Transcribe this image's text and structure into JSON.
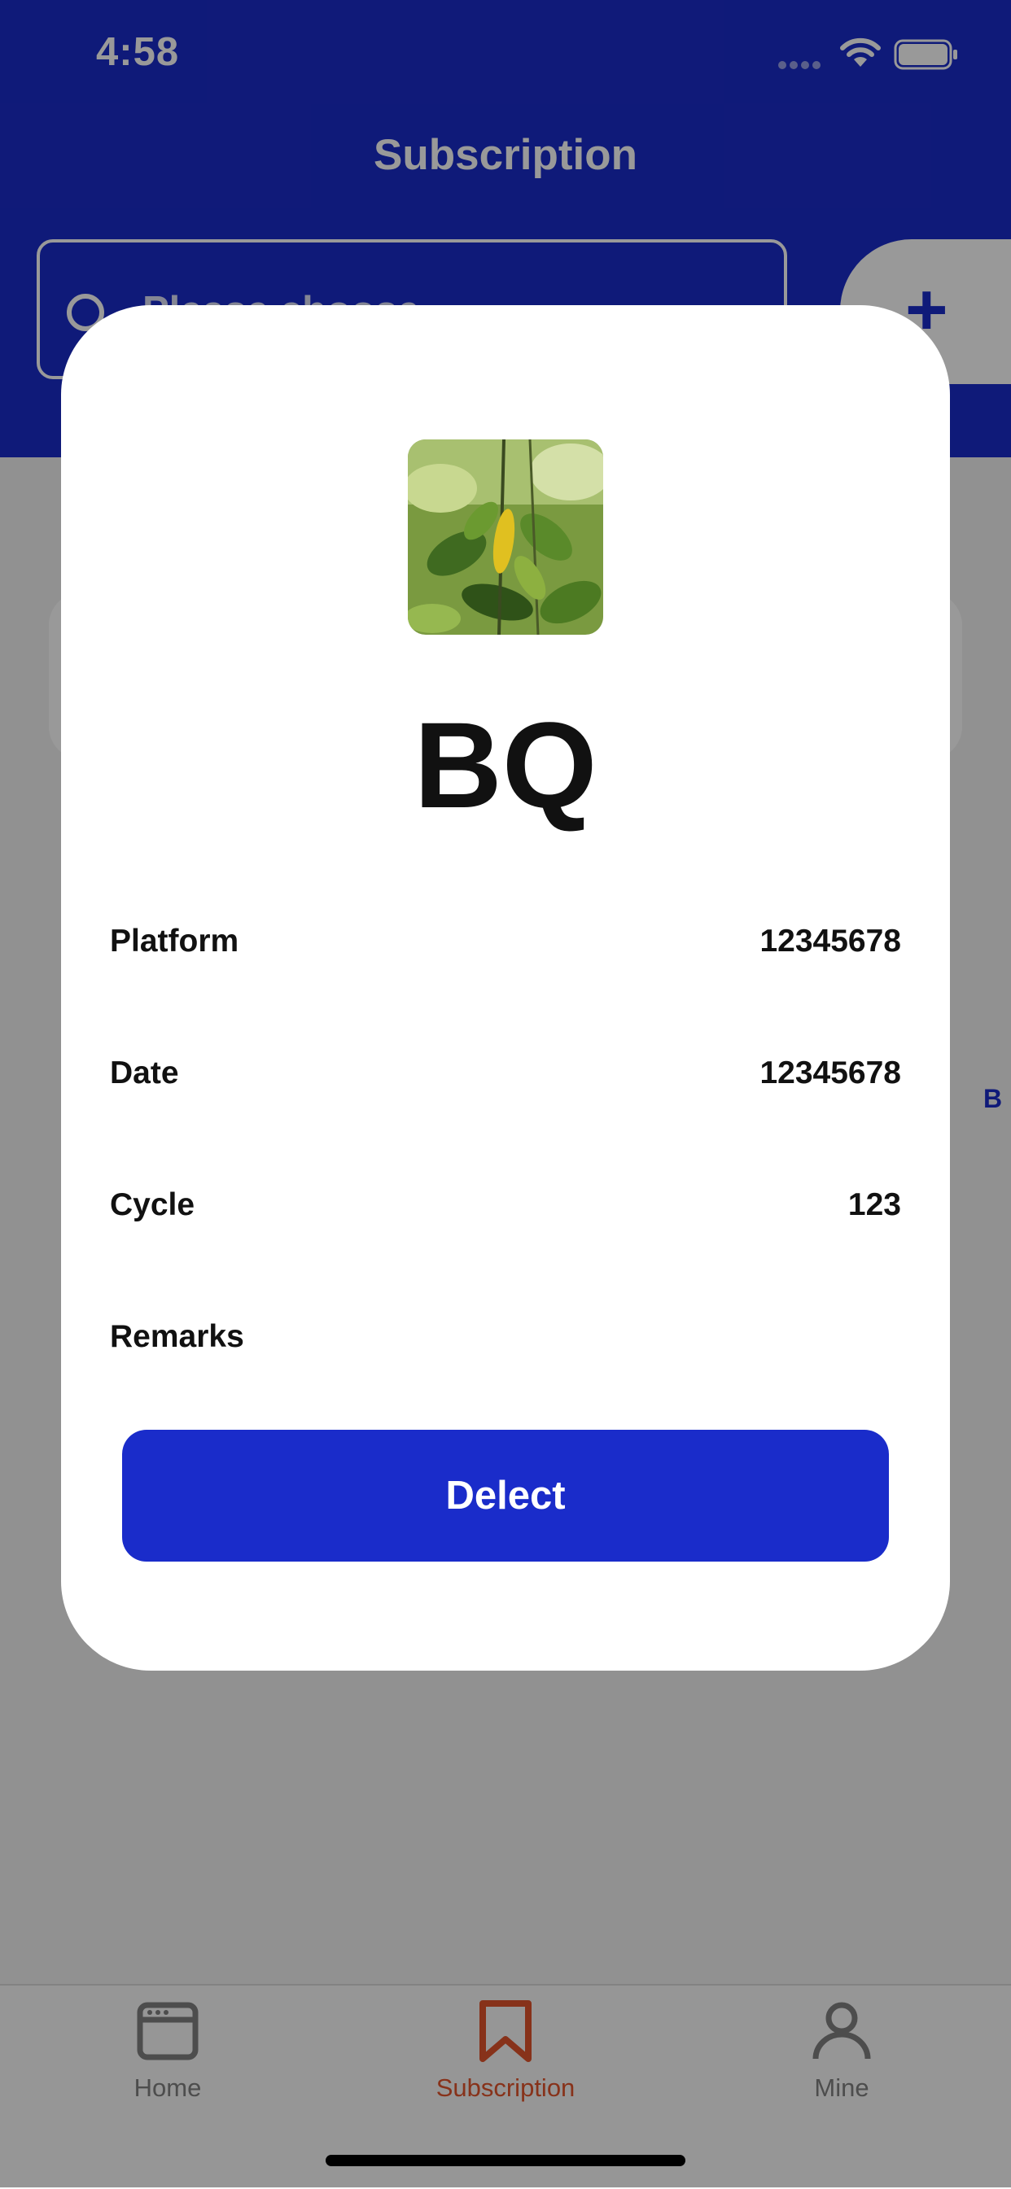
{
  "status_bar": {
    "time": "4:58"
  },
  "header": {
    "title": "Subscription",
    "search_placeholder": "Please choose",
    "add_label": "+"
  },
  "background": {
    "side_letter": "B"
  },
  "modal": {
    "name": "BQ",
    "rows": [
      {
        "label": "Platform",
        "value": "12345678"
      },
      {
        "label": "Date",
        "value": "12345678"
      },
      {
        "label": "Cycle",
        "value": "123"
      },
      {
        "label": "Remarks",
        "value": ""
      }
    ],
    "action_label": "Delect"
  },
  "tab_bar": {
    "items": [
      {
        "label": "Home",
        "icon": "browser-window-icon",
        "active": false
      },
      {
        "label": "Subscription",
        "icon": "bookmark-icon",
        "active": true
      },
      {
        "label": "Mine",
        "icon": "person-icon",
        "active": false
      }
    ]
  },
  "colors": {
    "brand": "#1a2cca",
    "active_tab": "#e2542c",
    "inactive_tab": "#808080",
    "overlay": "rgba(0,0,0,0.40)"
  }
}
